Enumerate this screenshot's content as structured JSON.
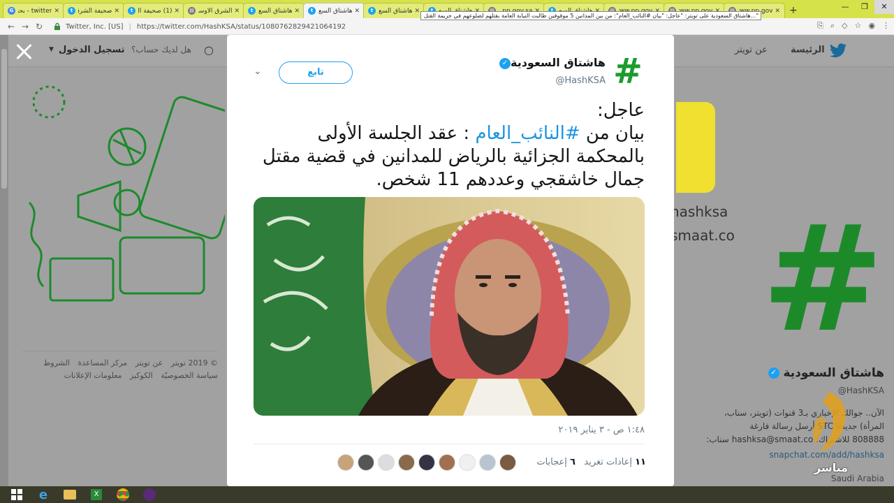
{
  "browser": {
    "tabs": [
      {
        "title": "twitter - بحث",
        "icon": "google-icon"
      },
      {
        "title": "صحيفة الشرق",
        "icon": "twitter-icon"
      },
      {
        "title": "(1) صحيفة ال",
        "icon": "twitter-icon"
      },
      {
        "title": "الشرق الأوسط",
        "icon": "page-icon"
      },
      {
        "title": "هاشتاق السع",
        "icon": "twitter-icon"
      },
      {
        "title": "هاشتاق السع",
        "icon": "twitter-icon"
      },
      {
        "title": "هاشتاق السع",
        "icon": "twitter-icon"
      },
      {
        "title": "هاشتاق السع",
        "icon": "twitter-icon"
      },
      {
        "title": "pp.gov.sa",
        "icon": "page-icon"
      },
      {
        "title": "هاشتاق السع",
        "icon": "twitter-icon"
      },
      {
        "title": "www.pp.gov",
        "icon": "page-icon"
      },
      {
        "title": "www.pp.gov",
        "icon": "page-icon"
      },
      {
        "title": "www.pp.gov",
        "icon": "page-icon"
      }
    ],
    "active_tab_index": 5,
    "tooltip": "\"...هاشتاق السعودية على تويتر: \"عاجل: \"بيان #النائب_العام\": من بين المدانين 5 موقوفين طالبت النيابة العامة بقتلهم لضلوعهم في جريمة القتل",
    "site_identity": "Twitter, Inc. [US]",
    "url": "https://twitter.com/HashKSA/status/1080762829421064192"
  },
  "twitter_nav": {
    "home": "الرئيسة",
    "about": "عن تويتر",
    "have_account": "هل لديك حساب؟",
    "login": "تسجيل الدخول"
  },
  "footer": {
    "links_line1": [
      "© 2019 تويتر",
      "عن تويتر",
      "مركز المساعدة",
      "الشروط"
    ],
    "links_line2": [
      "سياسة الخصوصيّة",
      "الكوكيز",
      "معلومات الإعلانات"
    ]
  },
  "side_profile": {
    "name": "هاشتاق السعودية",
    "handle": "@HashKSA",
    "bio_lines": [
      "الآن.. جوالك الإخباري بـ3 قنوات (تويتر، سناب،",
      "المرأة) جديدنا STC أرسل رسالة فارغة",
      "808888 للاشتراك: hashksa@smaat.co سناب:"
    ],
    "link": "snapchat.com/add/hashksa",
    "location": "Saudi Arabia",
    "snap_text_lines": [
      "hashksa",
      "smaat.co"
    ]
  },
  "tweet": {
    "name": "هاشتاق السعودية",
    "handle": "@HashKSA",
    "follow_label": "تابع",
    "text_prefix": "عاجل:",
    "text_before_tag": "بيان من ",
    "hashtag": "#النائب_العام",
    "text_after_tag": " : عقد الجلسة الأولى بالمحكمة الجزائية بالرياض للمدانين في قضية مقتل جمال خاشقجي وعددهم 11 شخص.",
    "timestamp": "١:٤٨ ص - ٣ يناير ٢٠١٩",
    "retweets_count": "١١",
    "retweets_label": "إعادات تغريد",
    "likes_count": "٦",
    "likes_label": "إعجابات"
  },
  "overlay": {
    "live_label": "مباشر"
  },
  "colors": {
    "twitter_blue": "#1da1f2",
    "hashtag_green": "#1c9b2e",
    "tab_bar": "#d6e24a"
  }
}
